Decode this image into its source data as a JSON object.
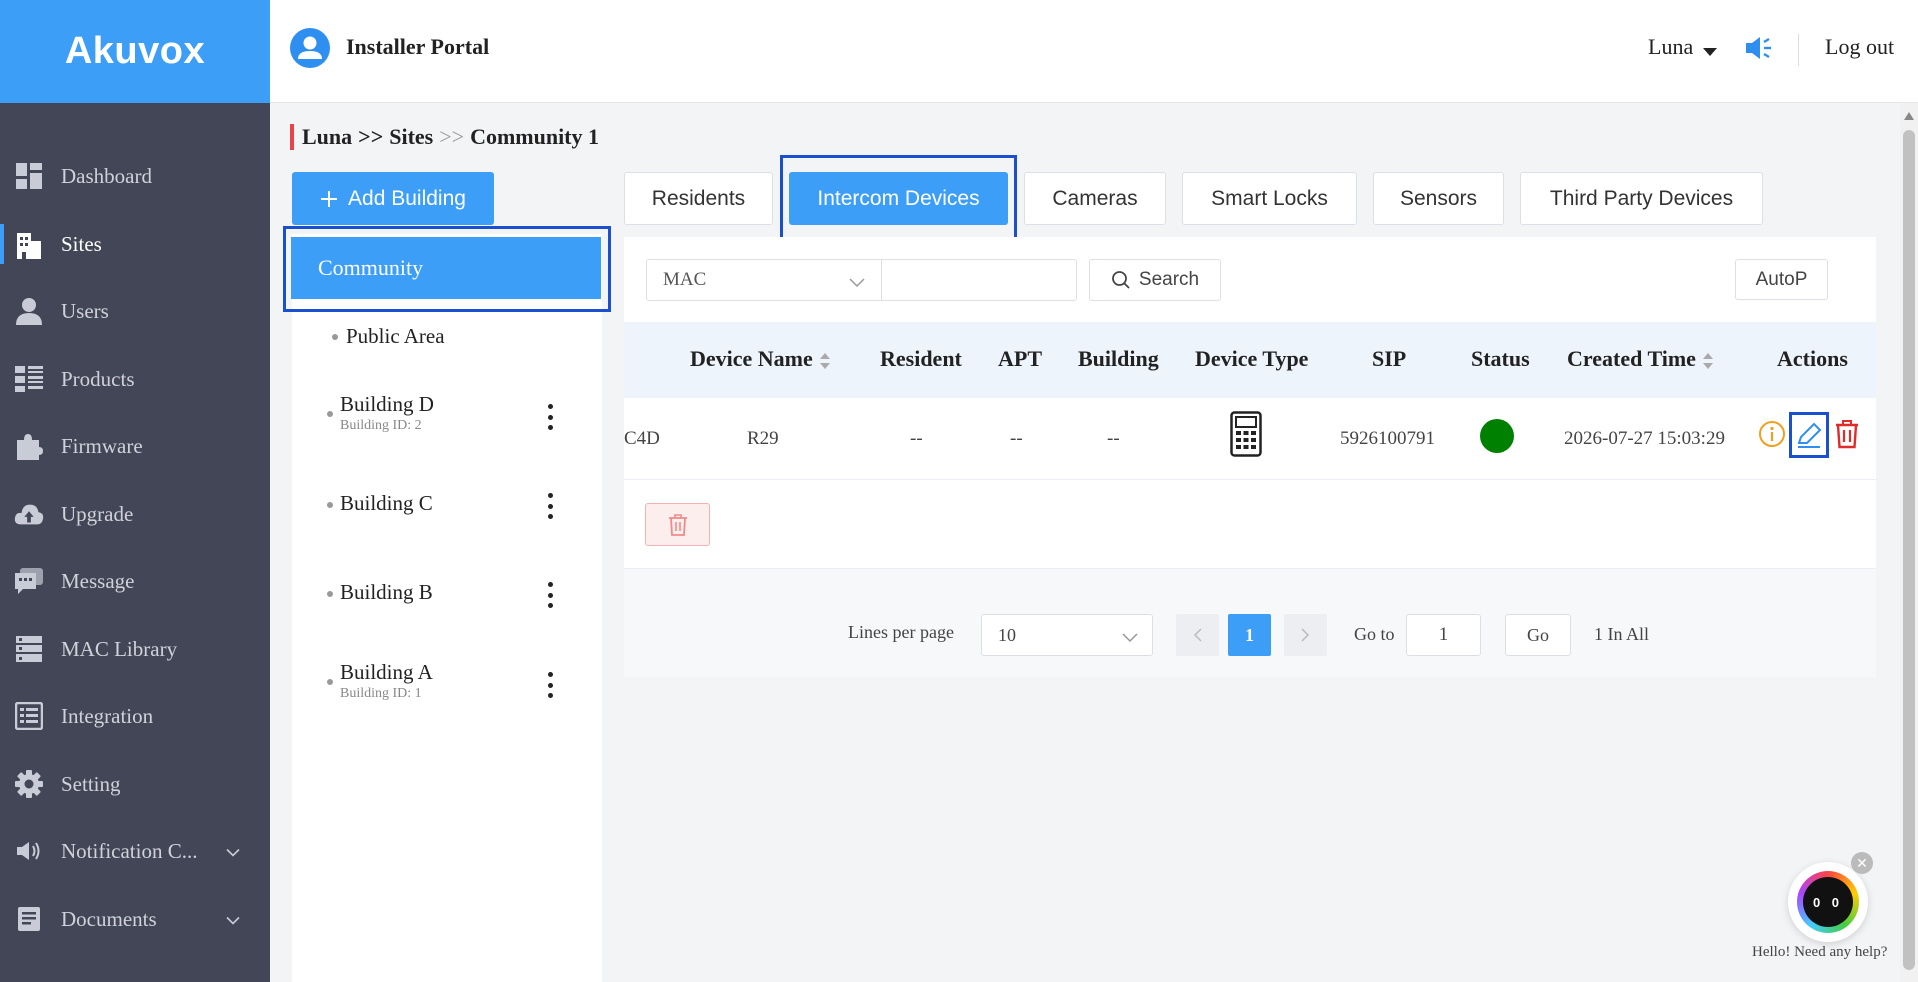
{
  "brand": {
    "logo": "Akuvox"
  },
  "header": {
    "title": "Installer Portal",
    "user": "Luna",
    "logout": "Log out"
  },
  "sidebar": {
    "items": [
      {
        "label": "Dashboard",
        "icon": "dashboard-icon"
      },
      {
        "label": "Sites",
        "icon": "building-icon",
        "active": true
      },
      {
        "label": "Users",
        "icon": "user-icon"
      },
      {
        "label": "Products",
        "icon": "list-icon"
      },
      {
        "label": "Firmware",
        "icon": "puzzle-icon"
      },
      {
        "label": "Upgrade",
        "icon": "cloud-upload-icon"
      },
      {
        "label": "Message",
        "icon": "message-icon"
      },
      {
        "label": "MAC Library",
        "icon": "server-icon"
      },
      {
        "label": "Integration",
        "icon": "integration-icon"
      },
      {
        "label": "Setting",
        "icon": "gear-icon"
      },
      {
        "label": "Notification C...",
        "icon": "speaker-icon",
        "expandable": true
      },
      {
        "label": "Documents",
        "icon": "document-icon",
        "expandable": true
      }
    ]
  },
  "breadcrumb": {
    "first": "Luna",
    "second": "Sites",
    "third": "Community 1",
    "sep": ">>"
  },
  "buildings": {
    "add_label": "Add Building",
    "root": "Community",
    "items": [
      {
        "name": "Public Area",
        "id_text": ""
      },
      {
        "name": "Building D",
        "id_text": "Building ID: 2"
      },
      {
        "name": "Building C",
        "id_text": ""
      },
      {
        "name": "Building B",
        "id_text": ""
      },
      {
        "name": "Building A",
        "id_text": "Building ID: 1"
      }
    ]
  },
  "tabs": [
    "Residents",
    "Intercom Devices",
    "Cameras",
    "Smart Locks",
    "Sensors",
    "Third Party Devices"
  ],
  "active_tab": "Intercom Devices",
  "filter": {
    "field": "MAC",
    "search_value": "",
    "search_label": "Search",
    "autop_label": "AutoP"
  },
  "table": {
    "columns": [
      "Device Name",
      "Resident",
      "APT",
      "Building",
      "Device Type",
      "SIP",
      "Status",
      "Created Time",
      "Actions"
    ],
    "rows": [
      {
        "mac": "C4D",
        "device_name": "R29",
        "resident": "--",
        "apt": "--",
        "building": "--",
        "device_type": "door-phone-icon",
        "sip": "5926100791",
        "status": "online",
        "created_time": "2026-07-27 15:03:29"
      }
    ]
  },
  "pagination": {
    "lines_label": "Lines per page",
    "page_size": "10",
    "current_page": "1",
    "goto_label": "Go to",
    "goto_value": "1",
    "go_label": "Go",
    "total": "1 In All"
  },
  "assistant": {
    "text": "Hello! Need any help?",
    "face": "0 0"
  },
  "colors": {
    "primary": "#3d9ef7",
    "sidebar": "#434656",
    "highlight_box": "#1a4fd0",
    "danger": "#e02b2b",
    "warning": "#f0a020",
    "online": "#008000"
  }
}
